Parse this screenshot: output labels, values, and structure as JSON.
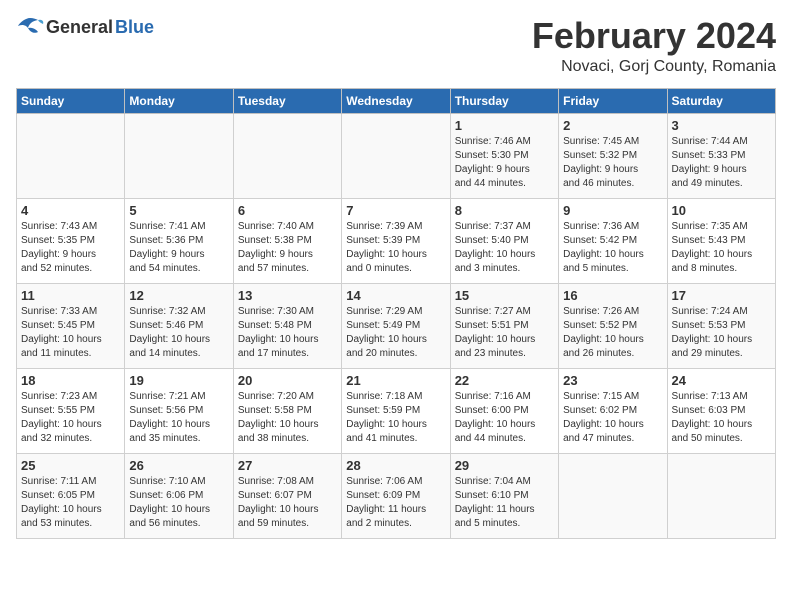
{
  "header": {
    "logo_general": "General",
    "logo_blue": "Blue",
    "month_title": "February 2024",
    "location": "Novaci, Gorj County, Romania"
  },
  "days_of_week": [
    "Sunday",
    "Monday",
    "Tuesday",
    "Wednesday",
    "Thursday",
    "Friday",
    "Saturday"
  ],
  "weeks": [
    [
      {
        "day": "",
        "info": ""
      },
      {
        "day": "",
        "info": ""
      },
      {
        "day": "",
        "info": ""
      },
      {
        "day": "",
        "info": ""
      },
      {
        "day": "1",
        "info": "Sunrise: 7:46 AM\nSunset: 5:30 PM\nDaylight: 9 hours\nand 44 minutes."
      },
      {
        "day": "2",
        "info": "Sunrise: 7:45 AM\nSunset: 5:32 PM\nDaylight: 9 hours\nand 46 minutes."
      },
      {
        "day": "3",
        "info": "Sunrise: 7:44 AM\nSunset: 5:33 PM\nDaylight: 9 hours\nand 49 minutes."
      }
    ],
    [
      {
        "day": "4",
        "info": "Sunrise: 7:43 AM\nSunset: 5:35 PM\nDaylight: 9 hours\nand 52 minutes."
      },
      {
        "day": "5",
        "info": "Sunrise: 7:41 AM\nSunset: 5:36 PM\nDaylight: 9 hours\nand 54 minutes."
      },
      {
        "day": "6",
        "info": "Sunrise: 7:40 AM\nSunset: 5:38 PM\nDaylight: 9 hours\nand 57 minutes."
      },
      {
        "day": "7",
        "info": "Sunrise: 7:39 AM\nSunset: 5:39 PM\nDaylight: 10 hours\nand 0 minutes."
      },
      {
        "day": "8",
        "info": "Sunrise: 7:37 AM\nSunset: 5:40 PM\nDaylight: 10 hours\nand 3 minutes."
      },
      {
        "day": "9",
        "info": "Sunrise: 7:36 AM\nSunset: 5:42 PM\nDaylight: 10 hours\nand 5 minutes."
      },
      {
        "day": "10",
        "info": "Sunrise: 7:35 AM\nSunset: 5:43 PM\nDaylight: 10 hours\nand 8 minutes."
      }
    ],
    [
      {
        "day": "11",
        "info": "Sunrise: 7:33 AM\nSunset: 5:45 PM\nDaylight: 10 hours\nand 11 minutes."
      },
      {
        "day": "12",
        "info": "Sunrise: 7:32 AM\nSunset: 5:46 PM\nDaylight: 10 hours\nand 14 minutes."
      },
      {
        "day": "13",
        "info": "Sunrise: 7:30 AM\nSunset: 5:48 PM\nDaylight: 10 hours\nand 17 minutes."
      },
      {
        "day": "14",
        "info": "Sunrise: 7:29 AM\nSunset: 5:49 PM\nDaylight: 10 hours\nand 20 minutes."
      },
      {
        "day": "15",
        "info": "Sunrise: 7:27 AM\nSunset: 5:51 PM\nDaylight: 10 hours\nand 23 minutes."
      },
      {
        "day": "16",
        "info": "Sunrise: 7:26 AM\nSunset: 5:52 PM\nDaylight: 10 hours\nand 26 minutes."
      },
      {
        "day": "17",
        "info": "Sunrise: 7:24 AM\nSunset: 5:53 PM\nDaylight: 10 hours\nand 29 minutes."
      }
    ],
    [
      {
        "day": "18",
        "info": "Sunrise: 7:23 AM\nSunset: 5:55 PM\nDaylight: 10 hours\nand 32 minutes."
      },
      {
        "day": "19",
        "info": "Sunrise: 7:21 AM\nSunset: 5:56 PM\nDaylight: 10 hours\nand 35 minutes."
      },
      {
        "day": "20",
        "info": "Sunrise: 7:20 AM\nSunset: 5:58 PM\nDaylight: 10 hours\nand 38 minutes."
      },
      {
        "day": "21",
        "info": "Sunrise: 7:18 AM\nSunset: 5:59 PM\nDaylight: 10 hours\nand 41 minutes."
      },
      {
        "day": "22",
        "info": "Sunrise: 7:16 AM\nSunset: 6:00 PM\nDaylight: 10 hours\nand 44 minutes."
      },
      {
        "day": "23",
        "info": "Sunrise: 7:15 AM\nSunset: 6:02 PM\nDaylight: 10 hours\nand 47 minutes."
      },
      {
        "day": "24",
        "info": "Sunrise: 7:13 AM\nSunset: 6:03 PM\nDaylight: 10 hours\nand 50 minutes."
      }
    ],
    [
      {
        "day": "25",
        "info": "Sunrise: 7:11 AM\nSunset: 6:05 PM\nDaylight: 10 hours\nand 53 minutes."
      },
      {
        "day": "26",
        "info": "Sunrise: 7:10 AM\nSunset: 6:06 PM\nDaylight: 10 hours\nand 56 minutes."
      },
      {
        "day": "27",
        "info": "Sunrise: 7:08 AM\nSunset: 6:07 PM\nDaylight: 10 hours\nand 59 minutes."
      },
      {
        "day": "28",
        "info": "Sunrise: 7:06 AM\nSunset: 6:09 PM\nDaylight: 11 hours\nand 2 minutes."
      },
      {
        "day": "29",
        "info": "Sunrise: 7:04 AM\nSunset: 6:10 PM\nDaylight: 11 hours\nand 5 minutes."
      },
      {
        "day": "",
        "info": ""
      },
      {
        "day": "",
        "info": ""
      }
    ]
  ]
}
